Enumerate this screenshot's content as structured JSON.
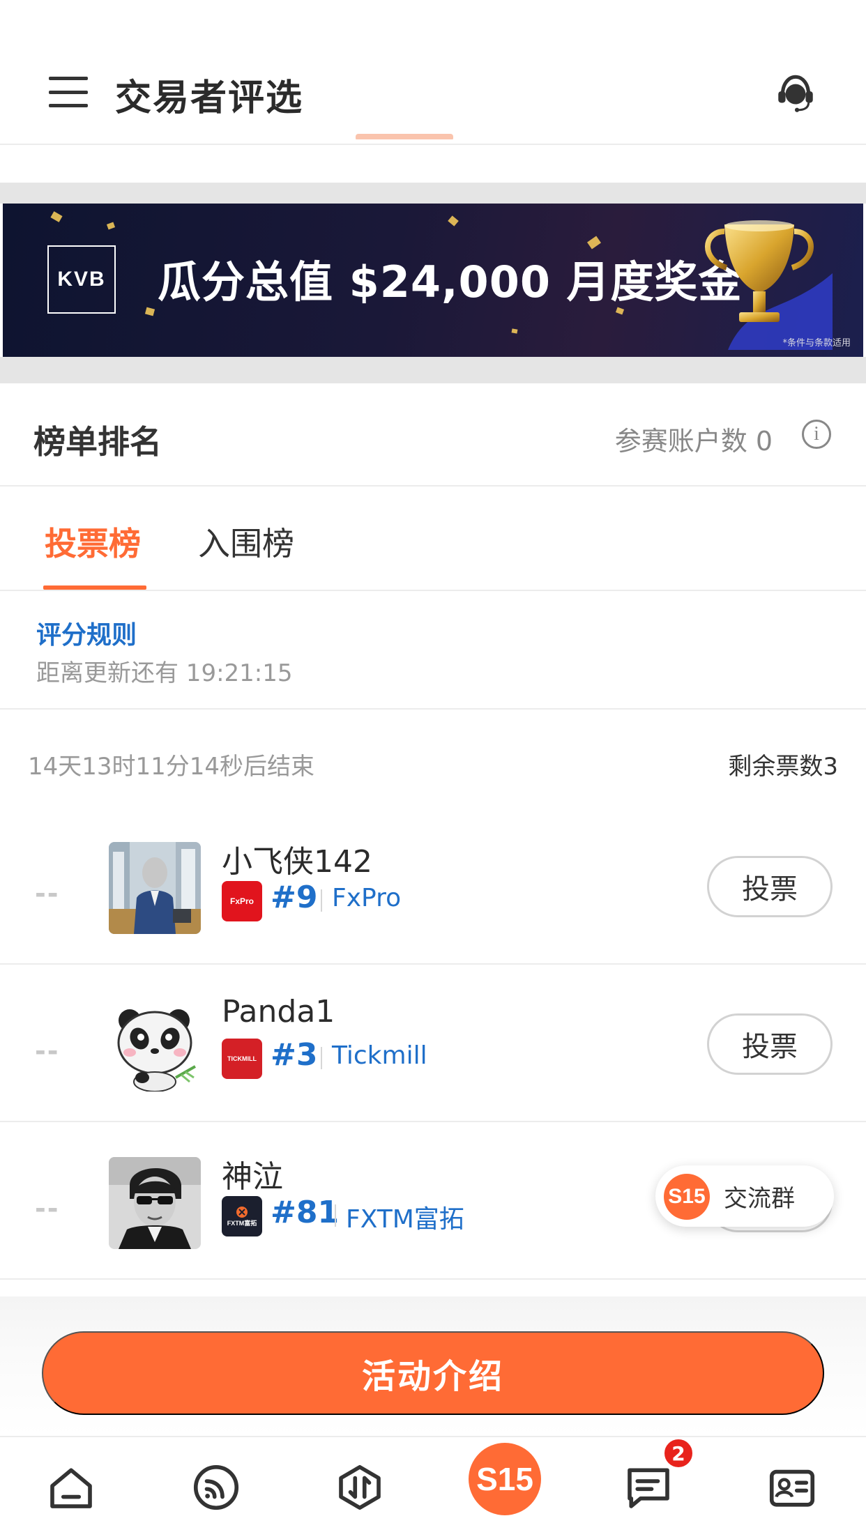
{
  "header": {
    "title": "交易者评选"
  },
  "banner": {
    "logo_text": "KVB",
    "headline": "瓜分总值 $24,000 月度奖金",
    "note": "*条件与条款适用"
  },
  "ranking": {
    "title": "榜单排名",
    "participant_count": "参赛账户数 0",
    "info_glyph": "i"
  },
  "tabs": [
    {
      "label": "投票榜",
      "active": true
    },
    {
      "label": "入围榜",
      "active": false
    }
  ],
  "rules": {
    "link": "评分规则",
    "countdown": "距离更新还有 19:21:15"
  },
  "list_meta": {
    "end_time": "14天13时11分14秒后结束",
    "remaining_votes": "剩余票数3"
  },
  "traders": [
    {
      "rank": "--",
      "name": "小飞侠142",
      "broker_rank": "#9",
      "broker": "FxPro",
      "badge_text": "FxPro",
      "badge_color": "#e1141d",
      "vote_label": "投票"
    },
    {
      "rank": "--",
      "name": "Panda1",
      "broker_rank": "#3",
      "broker": "Tickmill",
      "badge_text": "TICKMILL",
      "badge_color": "#d42026",
      "vote_label": "投票"
    },
    {
      "rank": "--",
      "name": "神泣",
      "broker_rank": "#81",
      "broker": "FXTM富拓",
      "badge_text": "FXTM富拓",
      "badge_color": "#1b1f2e",
      "vote_label": "投票"
    }
  ],
  "chat_chip": {
    "logo": "S15",
    "label": "交流群"
  },
  "cta": {
    "label": "活动介绍"
  },
  "tabbar": {
    "items": [
      "home-icon",
      "feed-icon",
      "trade-icon",
      "s15-icon",
      "messages-icon",
      "profile-card-icon"
    ],
    "center_label": "S15",
    "message_badge": "2"
  },
  "colors": {
    "accent": "#ff6b35",
    "link": "#1f6fc9"
  }
}
